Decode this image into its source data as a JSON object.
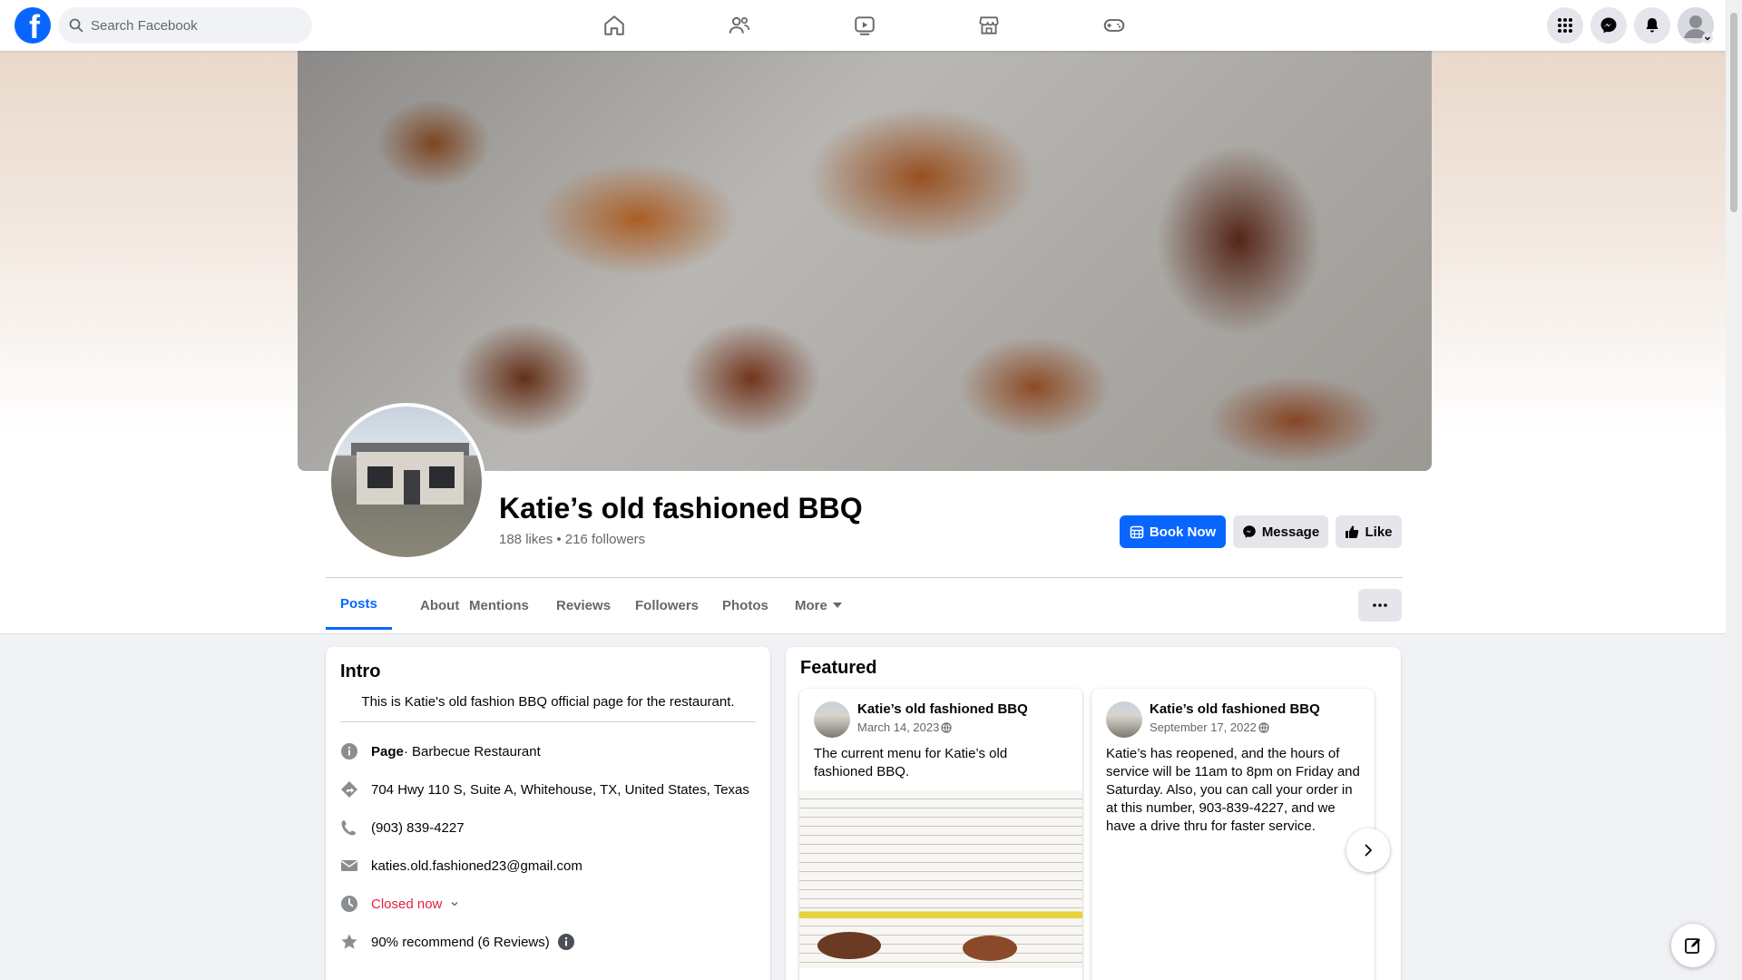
{
  "topbar": {
    "search_placeholder": "Search Facebook",
    "nav_tabs": [
      "home-icon",
      "friends-icon",
      "watch-icon",
      "marketplace-icon",
      "gaming-icon"
    ],
    "right_buttons": [
      "menu-grid-icon",
      "messenger-icon",
      "notifications-icon",
      "account-icon"
    ]
  },
  "page": {
    "name": "Katie’s old fashioned BBQ",
    "stats": "188 likes • 216 followers",
    "actions": {
      "book": "Book Now",
      "message": "Message",
      "like": "Like"
    }
  },
  "tabs": {
    "items": [
      "Posts",
      "About",
      "Mentions",
      "Reviews",
      "Followers",
      "Photos",
      "More"
    ],
    "active": "Posts"
  },
  "intro": {
    "title": "Intro",
    "bio": "This is Katie's old fashion BBQ official page for the restaurant.",
    "category_label": "Page",
    "category": " · Barbecue Restaurant",
    "address": "704 Hwy 110 S, Suite A, Whitehouse, TX, United States, Texas",
    "phone": "(903) 839-4227",
    "email": "katies.old.fashioned23@gmail.com",
    "hours": "Closed now",
    "rating": "90% recommend (6 Reviews)"
  },
  "featured": {
    "title": "Featured",
    "posts": [
      {
        "author": "Katie’s old fashioned BBQ",
        "date": "March 14, 2023",
        "text": "The current menu for Katie’s old fashioned BBQ."
      },
      {
        "author": "Katie’s old fashioned BBQ",
        "date": "September 17, 2022",
        "text": "Katie’s has reopened, and the hours of service will be 11am to 8pm on Friday and Saturday. Also, you can call your order in at this number, 903-839-4227, and we have a drive thru for faster service."
      }
    ]
  },
  "colors": {
    "brand": "#0866ff",
    "closed": "#e41e3f",
    "secondary_text": "#65676b"
  }
}
